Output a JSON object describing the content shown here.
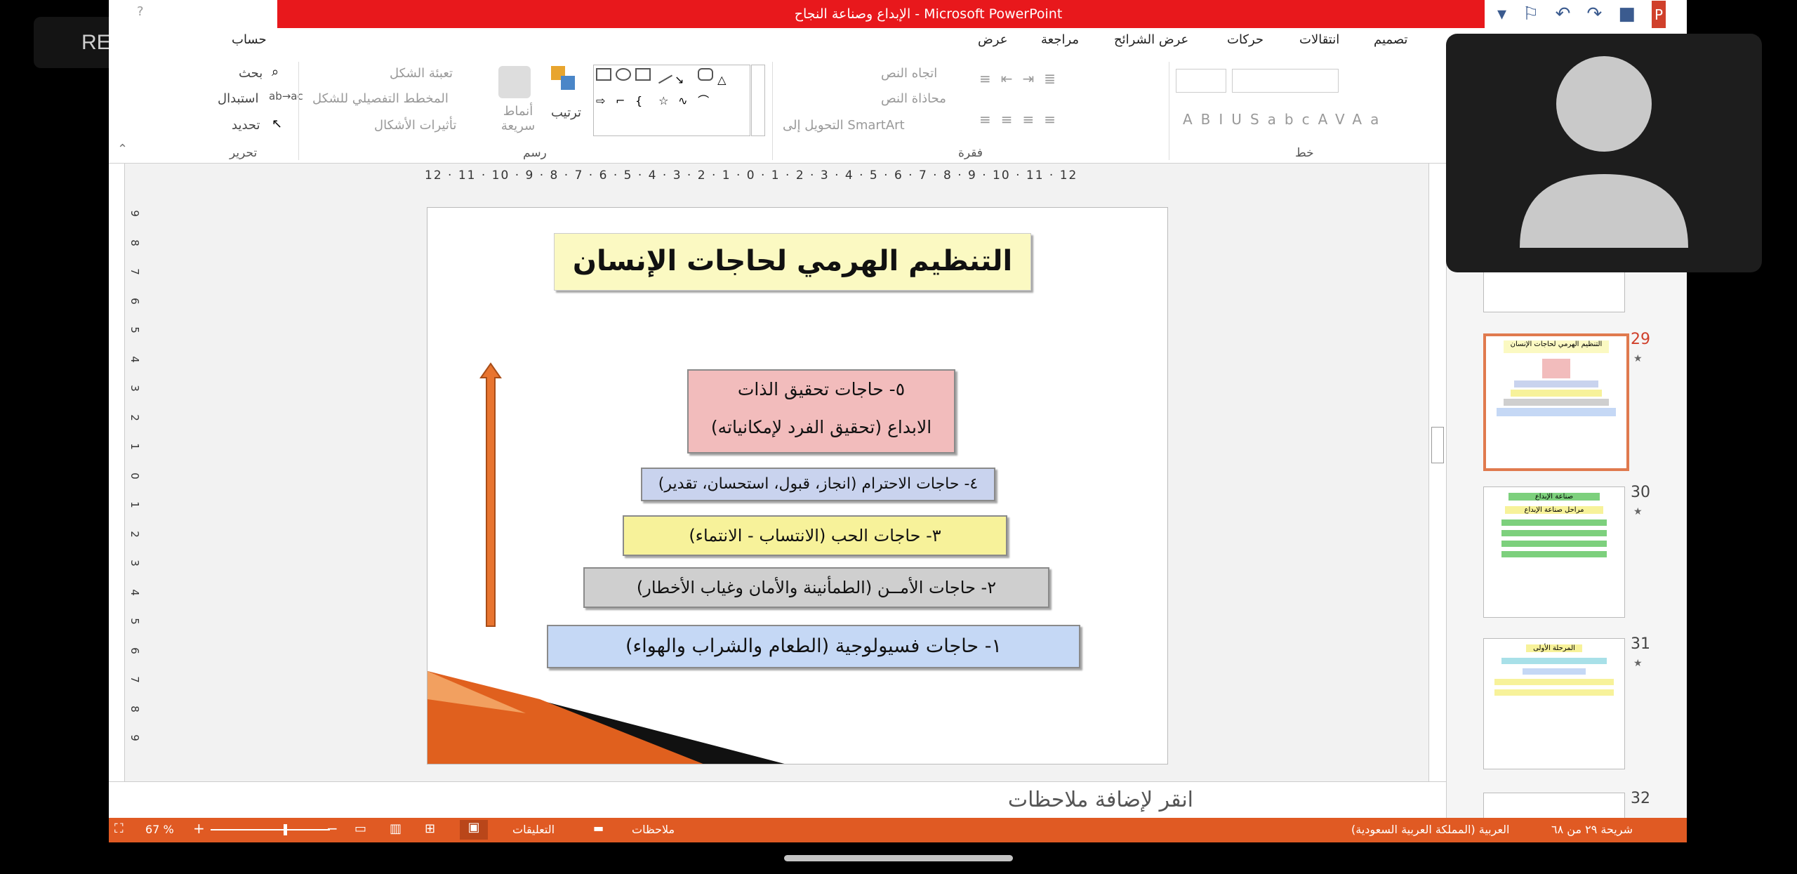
{
  "overlay": {
    "rec_label": "REC"
  },
  "window": {
    "title": "الإبداع وصناعة النجاح - Microsoft PowerPoint"
  },
  "tabs": [
    "عرض",
    "مراجعة",
    "عرض الشرائح",
    "حركات",
    "انتقالات",
    "تصميم"
  ],
  "account": "حساب",
  "ribbon": {
    "editing": {
      "find": "بحث",
      "replace": "استبدال",
      "select": "تحديد",
      "group": "تحرير"
    },
    "drawing": {
      "shape_fill": "تعبئة الشكل",
      "shape_outline": "المخطط التفصيلي للشكل",
      "shape_effects": "تأثيرات الأشكال",
      "quick_styles": "أنماط سريعة",
      "arrange": "ترتيب",
      "group": "رسم"
    },
    "paragraph": {
      "text_direction": "اتجاه النص",
      "align_text": "محاذاة النص",
      "convert_smartart": "التحويل إلى SmartArt",
      "group": "فقرة"
    },
    "font": {
      "group": "خط"
    }
  },
  "ruler": {
    "horizontal": "12 · 11 · 10 · 9 · 8 · 7 · 6 · 5 · 4 · 3 · 2 · 1 · 0 · 1 · 2 · 3 · 4 · 5 · 6 · 7 · 8 · 9 · 10 · 11 · 12",
    "vertical": [
      "9",
      "8",
      "7",
      "6",
      "5",
      "4",
      "3",
      "2",
      "1",
      "0",
      "1",
      "2",
      "3",
      "4",
      "5",
      "6",
      "7",
      "8",
      "9"
    ]
  },
  "slide": {
    "title": "التنظيم الهرمي لحاجات الإنسان",
    "level5_line1": "٥- حاجات تحقيق الذات",
    "level5_line2": "(تحقيق الفرد لإمكانياته) الابداع",
    "level4": "٤- حاجات الاحترام (انجاز، قبول، استحسان، تقدير)",
    "level3": "٣- حاجات الحب (الانتساب - الانتماء)",
    "level2": "٢- حاجات الأمــن (الطمأنينة والأمان وغياب الأخطار)",
    "level1": "١- حاجات فسيولوجية (الطعام والشراب والهواء)",
    "colors": {
      "level5": "#f2bcbc",
      "level4": "#c9d3ee",
      "level3": "#f7f29a",
      "level2": "#cfcfcf",
      "level1": "#c5d8f5",
      "arrow": "#e8742f",
      "title_bg": "#fbf9c2"
    }
  },
  "notes": {
    "placeholder": "انقر لإضافة ملاحظات"
  },
  "thumbnails": {
    "items": [
      {
        "num": "29",
        "star": "★",
        "title": "التنظيم الهرمي لحاجات الإنسان",
        "selected": true
      },
      {
        "num": "30",
        "star": "★",
        "title": "صناعة الإبداع",
        "subtitle": "مراحل صناعة الإبداع"
      },
      {
        "num": "31",
        "star": "★",
        "title": "المرحلة الأولى"
      },
      {
        "num": "32",
        "star": ""
      }
    ]
  },
  "status": {
    "slide_count": "شريحة ٢٩ من ٦٨",
    "language": "العربية (المملكة العربية السعودية)",
    "comments": "التعليقات",
    "notes": "ملاحظات",
    "zoom": "67 %"
  }
}
